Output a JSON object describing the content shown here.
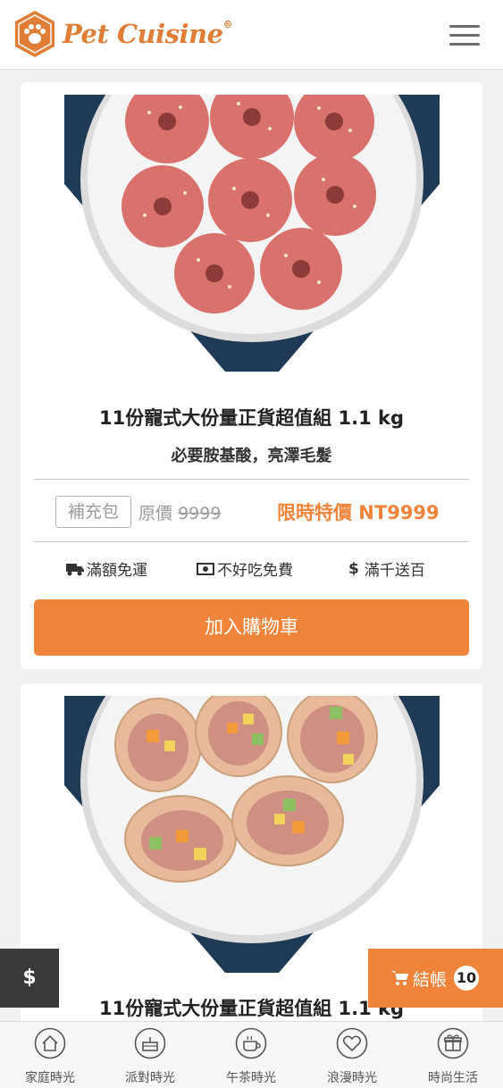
{
  "header": {
    "brand": "Pet Cuisine",
    "brand_mark": "®",
    "logo_icon": "paw-hexagon-icon",
    "menu_icon": "hamburger-menu-icon"
  },
  "products": [
    {
      "title": "11份寵式大份量正貨超值組 1.1 kg",
      "subtitle": "必要胺基酸，亮澤毛髮",
      "refill_label": "補充包",
      "orig_prefix": "原價",
      "orig_price": "9999",
      "sale_label": "限時特價 NT9999",
      "features": [
        {
          "icon": "truck-icon",
          "label": "滿額免運"
        },
        {
          "icon": "money-icon",
          "label": "不好吃免費"
        },
        {
          "icon": "dollar-icon",
          "label": "滿千送百"
        }
      ],
      "add_to_cart": "加入購物車"
    },
    {
      "title": "11份寵式大份量正貨超值組 1.1 kg"
    }
  ],
  "floating": {
    "dollar": "$",
    "checkout": "結帳",
    "cart_count": "10"
  },
  "tabs": [
    {
      "label": "家庭時光",
      "icon": "house-icon"
    },
    {
      "label": "派對時光",
      "icon": "cake-icon"
    },
    {
      "label": "午茶時光",
      "icon": "teacup-icon"
    },
    {
      "label": "浪漫時光",
      "icon": "heart-icon"
    },
    {
      "label": "時尚生活",
      "icon": "gift-icon"
    }
  ],
  "colors": {
    "accent": "#ef843a",
    "dark_float": "#3a3a3a",
    "navy": "#1f3a55"
  }
}
